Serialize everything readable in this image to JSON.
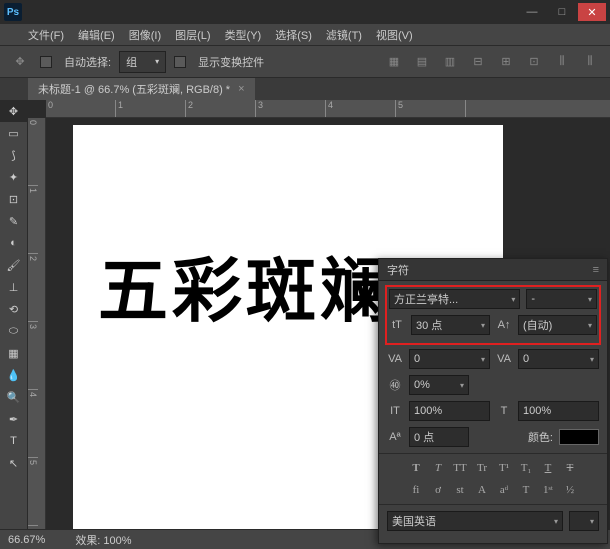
{
  "menu": {
    "items": [
      "文件(F)",
      "编辑(E)",
      "图像(I)",
      "图层(L)",
      "类型(Y)",
      "选择(S)",
      "滤镜(T)",
      "视图(V)"
    ]
  },
  "titlebar": {
    "minimize": "—",
    "maximize": "□",
    "close": "✕"
  },
  "options": {
    "auto_select": "自动选择:",
    "group": "组",
    "show_transform": "显示变换控件"
  },
  "doctab": {
    "title": "未标题-1 @ 66.7% (五彩斑斓, RGB/8) *"
  },
  "canvas": {
    "text": "五彩斑斓"
  },
  "rulers": {
    "h": [
      "0",
      "1",
      "2",
      "3",
      "4",
      "5"
    ],
    "v": [
      "0",
      "1",
      "2",
      "3",
      "4",
      "5"
    ]
  },
  "char": {
    "title": "字符",
    "font": "方正兰亭特...",
    "style": "-",
    "size": "30 点",
    "leading": "(自动)",
    "va": "0",
    "va2": "0",
    "scale": "0%",
    "h_scale": "100%",
    "v_scale": "100%",
    "baseline": "0 点",
    "color_label": "颜色:",
    "lang": "美国英语",
    "icons": {
      "tt": "tT",
      "a_up": "A↑",
      "t_big": "T",
      "t_small": "T",
      "va_i": "VA",
      "va2_i": "VA",
      "it": "IT",
      "tscale": "T",
      "aa": "Aª",
      "ttu": "TT",
      "ttc": "Tr",
      "tsc": "T¹",
      "tsub": "T₁",
      "tstrk": "T",
      "fi": "fi",
      "st": "st",
      "aalpha": "A",
      "ad": "aᵈ",
      "t1": "T",
      "half": "1ˢᵗ",
      "halfb": "½"
    }
  },
  "status": {
    "zoom": "66.67%",
    "effect": "效果: 100%"
  }
}
